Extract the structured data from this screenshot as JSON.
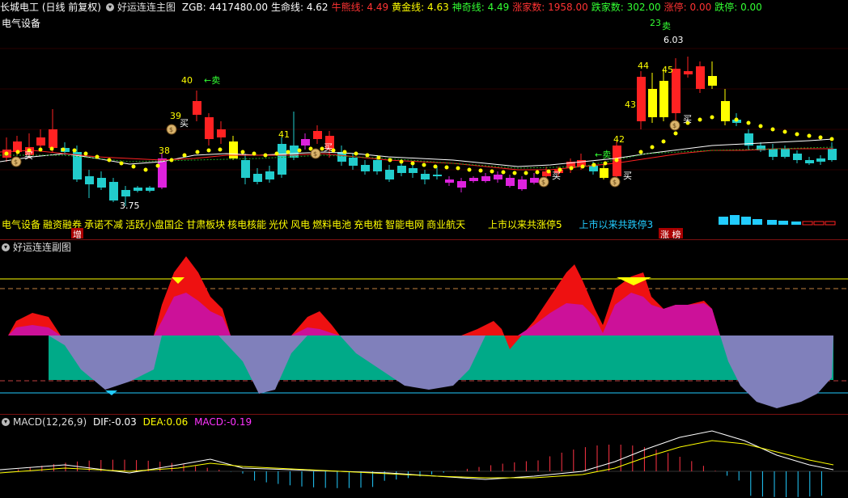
{
  "main": {
    "stock_title": "长城电工 (日线 前复权)",
    "indicator_name": "好运连连主图",
    "values": [
      {
        "label": "ZGB:",
        "value": "4417480.00",
        "color": "#ffffff"
      },
      {
        "label": "生命线:",
        "value": "4.62",
        "color": "#ffffff"
      },
      {
        "label": "牛熊线:",
        "value": "4.49",
        "color": "#ff3333"
      },
      {
        "label": "黄金线:",
        "value": "4.63",
        "color": "#ffff00"
      },
      {
        "label": "神奇线:",
        "value": "4.49",
        "color": "#33ff33"
      },
      {
        "label": "涨家数:",
        "value": "1958.00",
        "color": "#ff3333"
      },
      {
        "label": "跌家数:",
        "value": "302.00",
        "color": "#33ff33"
      },
      {
        "label": "涨停:",
        "value": "0.00",
        "color": "#ff3333"
      },
      {
        "label": "跌停:",
        "value": "0.00",
        "color": "#33ff33"
      }
    ],
    "sector_label": "电气设备",
    "concepts": [
      "电气设备",
      "融资融券",
      "承诺不减",
      "活跃小盘国企",
      "甘肃板块",
      "核电核能",
      "光伏",
      "风电",
      "燃料电池",
      "充电桩",
      "智能电网",
      "商业航天"
    ],
    "limit_up_text": "上市以来共涨停5",
    "limit_down_text": "上市以来共跌停3",
    "tag_increase": "增",
    "tag_limit": "涨 榜",
    "annotations": {
      "buy": "买",
      "sell": "卖",
      "sell_arrow": "←卖",
      "low_price": "3.75",
      "high_price": "6.03",
      "nums": [
        "40",
        "39",
        "38",
        "41",
        "42",
        "43",
        "44",
        "45",
        "23"
      ]
    },
    "colors": {
      "up": "#ff2222",
      "down": "#22cccc",
      "gold": "#ffff00",
      "magenta": "#dd22dd",
      "white": "#ffffff"
    }
  },
  "sub": {
    "indicator_name": "好运连连副图"
  },
  "macd": {
    "name": "MACD(12,26,9)",
    "dif_label": "DIF:",
    "dif_value": "-0.03",
    "dea_label": "DEA:",
    "dea_value": "0.06",
    "macd_label": "MACD:",
    "macd_value": "-0.19"
  }
}
